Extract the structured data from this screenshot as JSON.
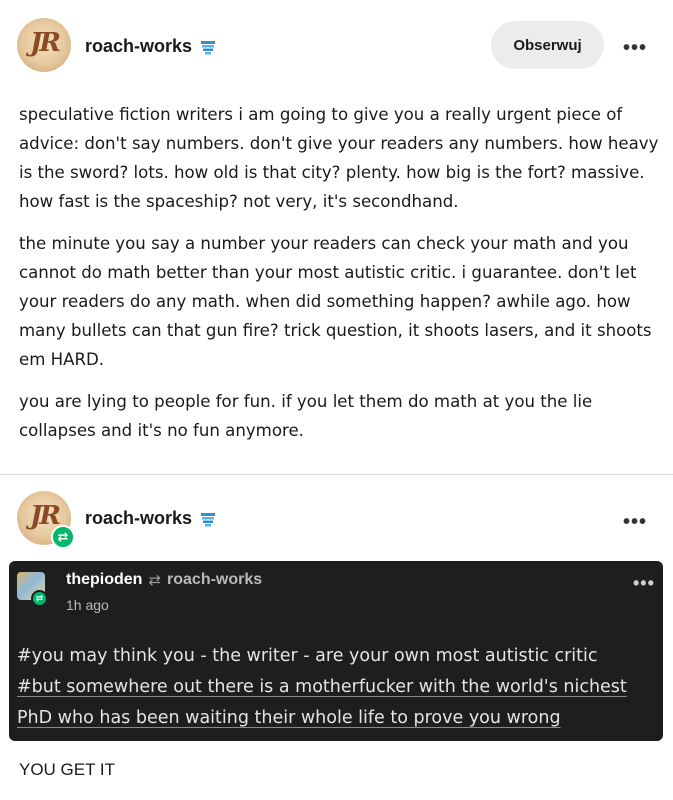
{
  "post1": {
    "avatar_initials": "JR",
    "username": "roach-works",
    "follow_label": "Obserwuj",
    "more_label": "•••",
    "paragraphs": [
      "speculative fiction writers i am going to give you a really urgent piece of advice: don't say numbers. don't give your readers any numbers. how heavy is the sword? lots. how old is that city? plenty. how big is the fort? massive. how fast is the spaceship? not very, it's secondhand.",
      "the minute you say a number your readers can check your math and you cannot do math better than your most autistic critic. i guarantee. don't let your readers do any math. when did something happen? awhile ago. how many bullets can that gun fire? trick question, it shoots lasers, and it shoots em HARD.",
      "you are lying to people for fun. if you let them do math at you the lie collapses and it's no fun anymore."
    ]
  },
  "post2": {
    "avatar_initials": "JR",
    "reblog_glyph": "⇄",
    "username": "roach-works",
    "more_label": "•••",
    "quote": {
      "username": "thepioden",
      "reblog_glyph": "⇄",
      "source": "roach-works",
      "time": "1h ago",
      "more_label": "•••",
      "tags": [
        "#you may think you - the writer - are your own most autistic critic",
        "#but somewhere out there is a motherfucker with the world's nichest",
        "PhD who has been waiting their whole life to prove you wrong"
      ]
    },
    "reply": "YOU GET IT"
  },
  "colors": {
    "accent_green": "#00b86a",
    "dark_panel": "#1e1e1e",
    "badge_blue": "#2f8fd0"
  },
  "icons": {
    "verified_badge": "blue-pennant-badge-icon",
    "more": "ellipsis-icon",
    "reblog": "reblog-icon"
  }
}
